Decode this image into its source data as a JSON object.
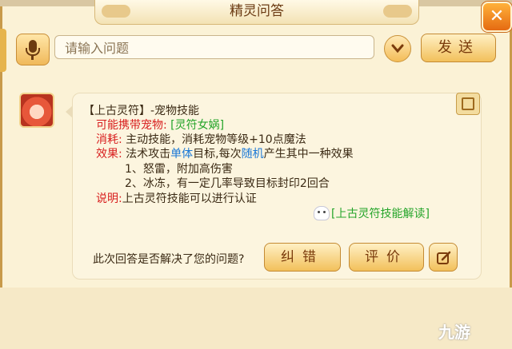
{
  "window": {
    "title": "精灵问答",
    "close_glyph": "✕"
  },
  "input": {
    "placeholder": "请输入问题",
    "value": ""
  },
  "buttons": {
    "send": "发送",
    "report": "纠错",
    "rate": "评价"
  },
  "answer": {
    "heading": "【上古灵符】-宠物技能",
    "pet_label": "可能携带宠物:",
    "pet_value": "[灵符女娲]",
    "cost_label": "消耗:",
    "cost_value": "主动技能，消耗宠物等级+10点魔法",
    "effect_label": "效果:",
    "effect_pre": "法术攻击",
    "effect_single": "单体",
    "effect_mid": "目标,每次",
    "effect_random": "随机",
    "effect_post": "产生其中一种效果",
    "effect_item1": "1、怒雷，附加高伤害",
    "effect_item2": "2、冰冻，有一定几率导致目标封印2回合",
    "note_label": "说明:",
    "note_value": "上古灵符技能可以进行认证",
    "link": "[上古灵符技能解读]"
  },
  "feedback": {
    "question": "此次回答是否解决了您的问题?"
  },
  "watermark": "九游",
  "colors": {
    "red": "#d81e1e",
    "green": "#25a52a",
    "blue": "#1a78d6",
    "button": "#f2c05b"
  },
  "icons": [
    "mic-icon",
    "chevron-down-icon",
    "scroll-icon",
    "ghost-icon",
    "edit-icon",
    "close-icon"
  ]
}
